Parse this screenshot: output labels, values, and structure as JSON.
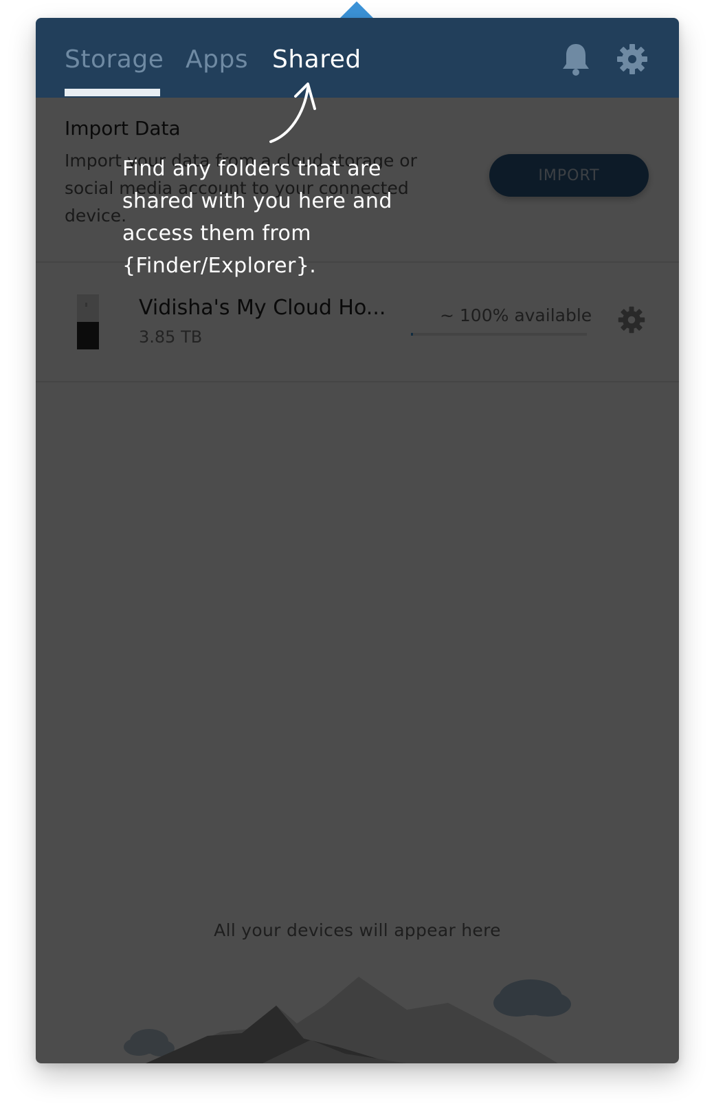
{
  "tabs": [
    {
      "label": "Storage",
      "selected": false
    },
    {
      "label": "Apps",
      "selected": false
    },
    {
      "label": "Shared",
      "selected": true
    }
  ],
  "header": {
    "icons": [
      "bell-icon",
      "gear-icon"
    ],
    "background_color": "#223f5b"
  },
  "import": {
    "title": "Import Data",
    "description": "Import your data from a cloud storage or social media account to your connected device.",
    "button_label": "IMPORT"
  },
  "device": {
    "name": "Vidisha's My Cloud Ho...",
    "size": "3.85 TB",
    "availability": "~ 100% available",
    "used_fraction": 0.01
  },
  "empty_state": {
    "text": "All your devices will appear here"
  },
  "coach_mark": {
    "text": "Find any folders that are shared with you here and access them from {Finder/Explorer}."
  },
  "colors": {
    "accent": "#3c93d8",
    "header": "#223f5b",
    "button": "#2d5a86"
  }
}
